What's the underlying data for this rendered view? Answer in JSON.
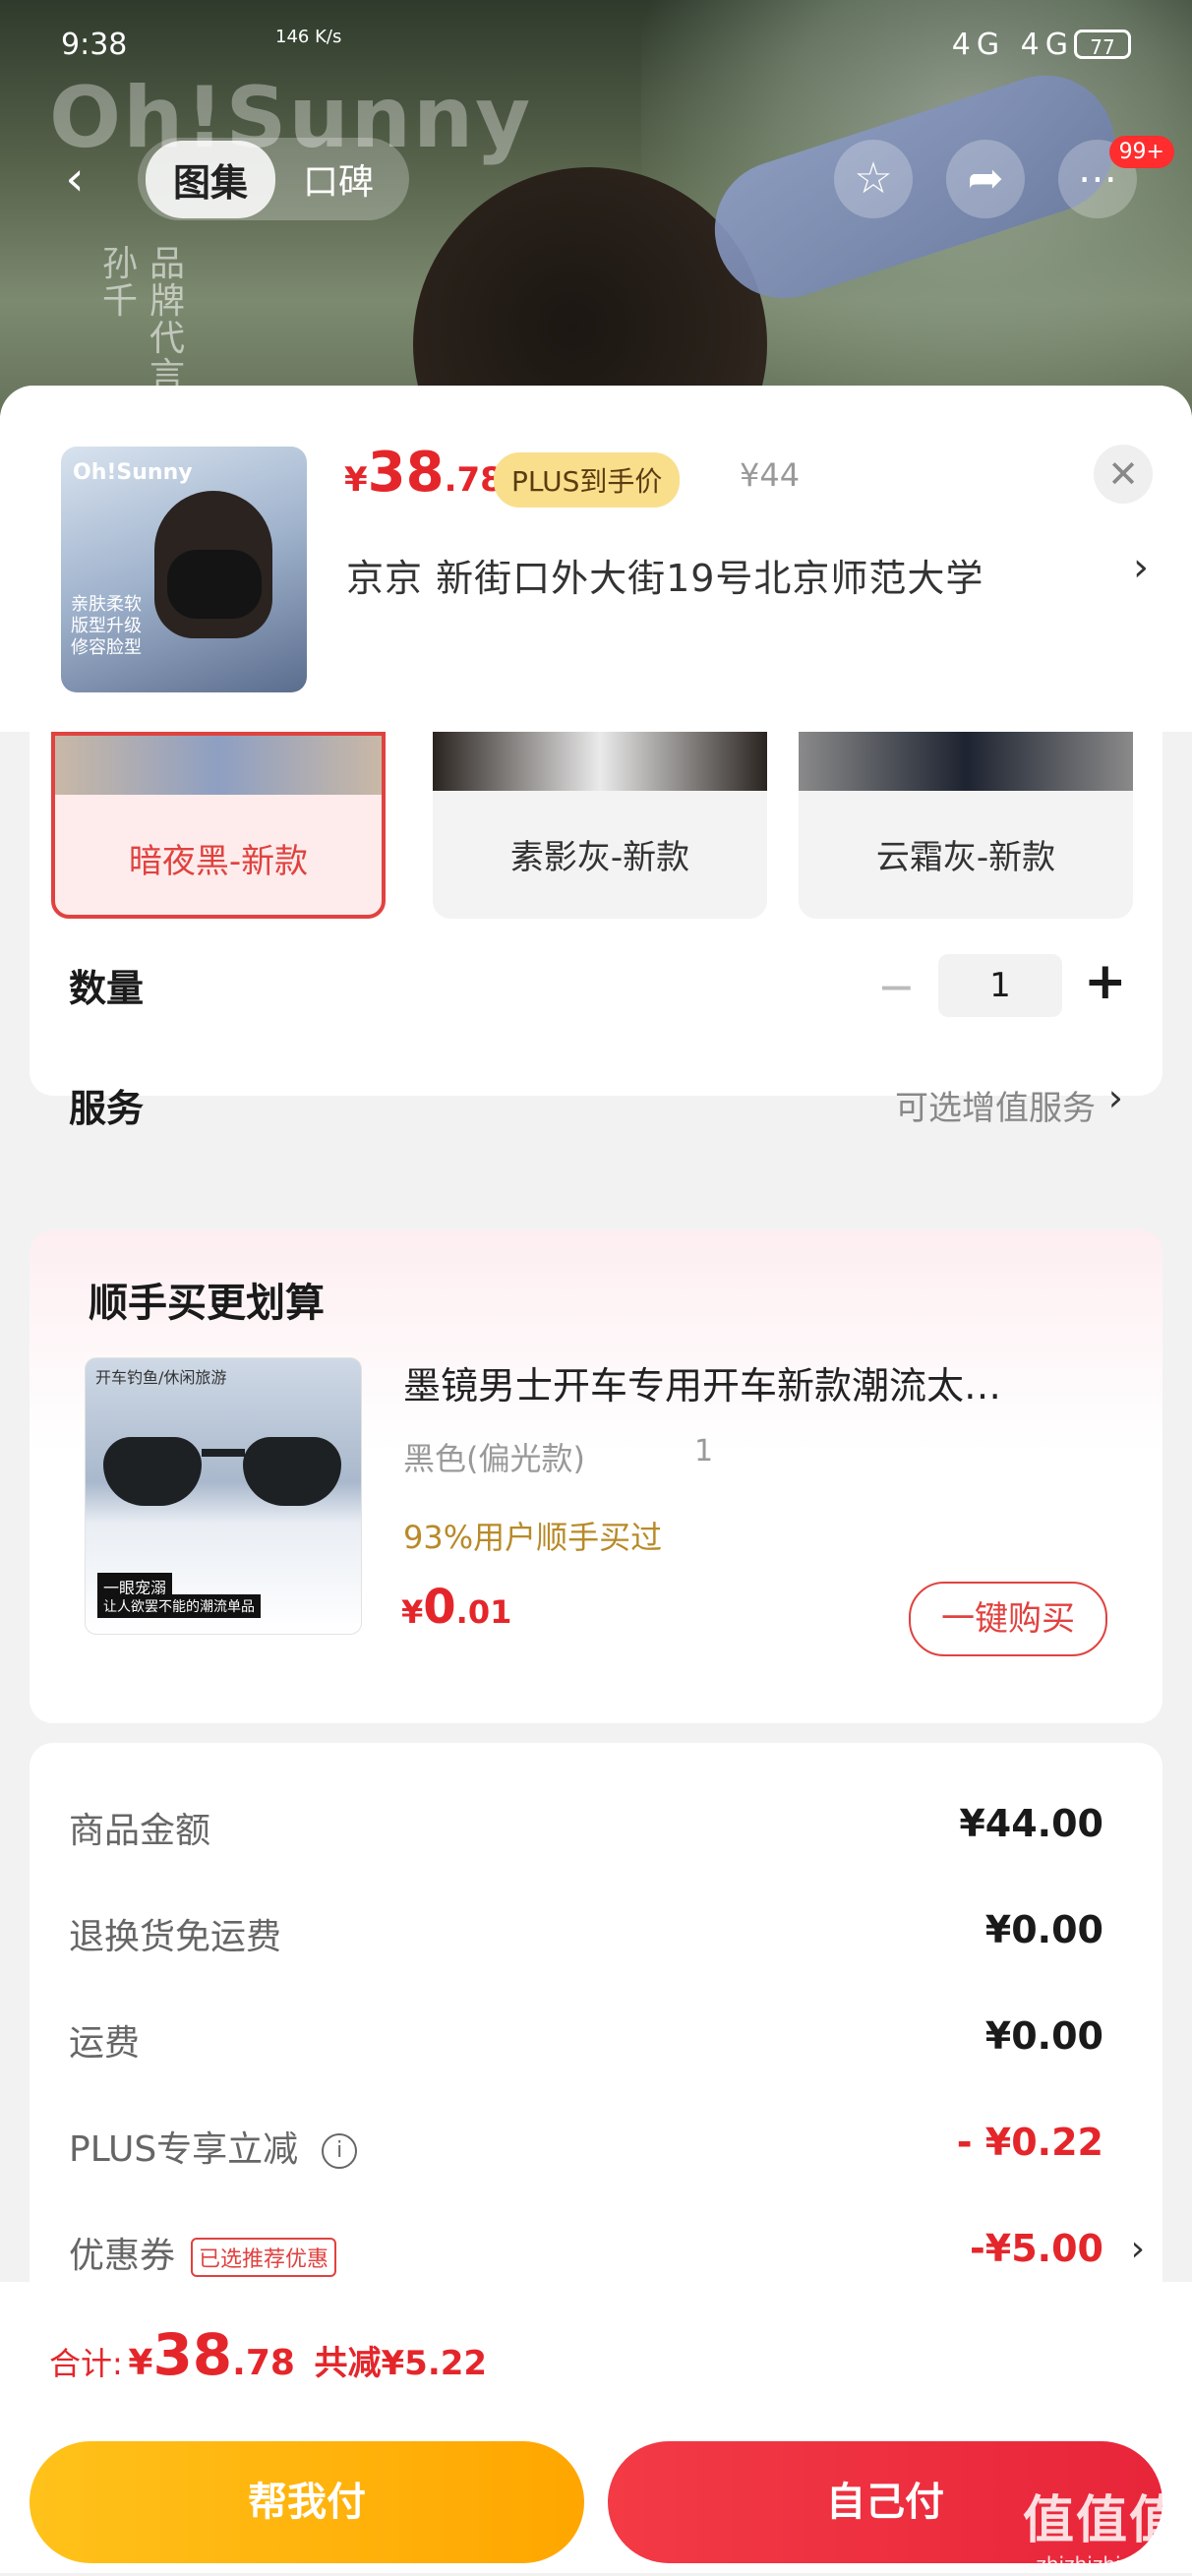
{
  "status_bar": {
    "time": "9:38",
    "speed": "146 K/s",
    "signal": "4G 4G",
    "battery": "77"
  },
  "background": {
    "brand": "Oh!Sunny",
    "vertical_text_1": "孙千",
    "vertical_text_2": "品牌代言"
  },
  "top_nav": {
    "tabs": [
      {
        "label": "图集",
        "active": true
      },
      {
        "label": "口碑",
        "active": false
      }
    ],
    "badge": "99+"
  },
  "product": {
    "thumb_brand": "Oh!Sunny",
    "thumb_text": "亲肤柔软 版型升级 修容脸型",
    "price_symbol": "¥",
    "price_int": "38",
    "price_dec": ".78",
    "plus_tag": "PLUS到手价",
    "original_price": "¥44",
    "address": "京京   新街口外大街19号北京师范大学"
  },
  "variants": [
    {
      "label": "暗夜黑-新款",
      "selected": true
    },
    {
      "label": "素影灰-新款",
      "selected": false
    },
    {
      "label": "云霜灰-新款",
      "selected": false
    }
  ],
  "quantity": {
    "label": "数量",
    "value": "1"
  },
  "service": {
    "label": "服务",
    "option": "可选增值服务"
  },
  "addon": {
    "title": "顺手买更划算",
    "img_caption": "开车钓鱼/休闲旅游",
    "img_tag1": "一眼宠溺",
    "img_tag2": "让人欲罢不能的潮流单品",
    "name": "墨镜男士开车专用开车新款潮流太…",
    "spec": "黑色(偏光款)",
    "count": "1",
    "hint": "93%用户顺手买过",
    "price_symbol": "¥",
    "price_int": "0",
    "price_dec": ".01",
    "button": "一键购买"
  },
  "summary": [
    {
      "label": "商品金额",
      "value": "¥44.00"
    },
    {
      "label": "退换货免运费",
      "value": "¥0.00"
    },
    {
      "label": "运费",
      "value": "¥0.00"
    },
    {
      "label": "PLUS专享立减",
      "value": "- ¥0.22"
    },
    {
      "label": "优惠券",
      "tag": "已选推荐优惠",
      "value": "-¥5.00"
    }
  ],
  "footer": {
    "total_label": "合计:",
    "total_symbol": "¥",
    "total_int": "38",
    "total_dec": ".78",
    "saved": "共减¥5.22",
    "help_pay": "帮我付",
    "self_pay": "自己付"
  },
  "watermark": {
    "main": "值值值",
    "sub": "zhizhizhi.com"
  },
  "colors": {
    "accent_red": "#e4262b",
    "plus_gold": "#f9df8c",
    "help_btn": "#ffb300",
    "self_btn": "#ee2f40"
  }
}
